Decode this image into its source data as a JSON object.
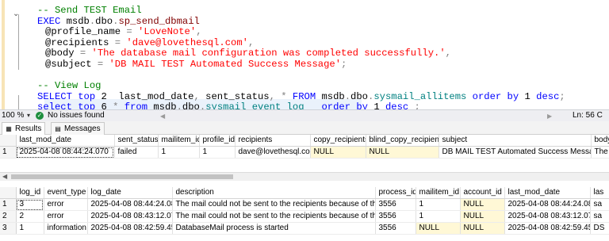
{
  "editor": {
    "lines": [
      [
        {
          "t": "-- Send TEST Email",
          "c": "cmt"
        }
      ],
      [
        {
          "t": "EXEC ",
          "c": "kw"
        },
        {
          "t": "msdb",
          "c": "blk"
        },
        {
          "t": ".",
          "c": "gray"
        },
        {
          "t": "dbo",
          "c": "blk"
        },
        {
          "t": ".",
          "c": "gray"
        },
        {
          "t": "sp_send_dbmail",
          "c": "fn"
        }
      ],
      [
        {
          "t": "@profile_name ",
          "c": "blk"
        },
        {
          "t": "= ",
          "c": "gray"
        },
        {
          "t": "'LoveNote'",
          "c": "str"
        },
        {
          "t": ",",
          "c": "gray"
        }
      ],
      [
        {
          "t": "@recipients ",
          "c": "blk"
        },
        {
          "t": "= ",
          "c": "gray"
        },
        {
          "t": "'dave@lovethesql.com'",
          "c": "str"
        },
        {
          "t": ",",
          "c": "gray"
        }
      ],
      [
        {
          "t": "@body ",
          "c": "blk"
        },
        {
          "t": "= ",
          "c": "gray"
        },
        {
          "t": "'The database mail configuration was completed successfully.'",
          "c": "str"
        },
        {
          "t": ",",
          "c": "gray"
        }
      ],
      [
        {
          "t": "@subject ",
          "c": "blk"
        },
        {
          "t": "= ",
          "c": "gray"
        },
        {
          "t": "'DB MAIL TEST Automated Success Message'",
          "c": "str"
        },
        {
          "t": ";",
          "c": "gray"
        }
      ],
      [],
      [
        {
          "t": "-- View Log",
          "c": "cmt"
        }
      ],
      [
        {
          "t": "SELECT ",
          "c": "kw"
        },
        {
          "t": "top ",
          "c": "kw"
        },
        {
          "t": "2  ",
          "c": "blk"
        },
        {
          "t": "last_mod_date",
          "c": "blk"
        },
        {
          "t": ", ",
          "c": "gray"
        },
        {
          "t": "sent_status",
          "c": "blk"
        },
        {
          "t": ", ",
          "c": "gray"
        },
        {
          "t": "* ",
          "c": "gray"
        },
        {
          "t": "FROM ",
          "c": "kw"
        },
        {
          "t": "msdb",
          "c": "blk"
        },
        {
          "t": ".",
          "c": "gray"
        },
        {
          "t": "dbo",
          "c": "blk"
        },
        {
          "t": ".",
          "c": "gray"
        },
        {
          "t": "sysmail_allitems ",
          "c": "obj"
        },
        {
          "t": "order by ",
          "c": "kw"
        },
        {
          "t": "1 ",
          "c": "blk"
        },
        {
          "t": "desc",
          "c": "kw"
        },
        {
          "t": ";",
          "c": "gray"
        }
      ],
      [
        {
          "t": "select ",
          "c": "kw"
        },
        {
          "t": "top ",
          "c": "kw"
        },
        {
          "t": "6 ",
          "c": "blk"
        },
        {
          "t": "* ",
          "c": "gray"
        },
        {
          "t": "from ",
          "c": "kw"
        },
        {
          "t": "msdb",
          "c": "blk"
        },
        {
          "t": ".",
          "c": "gray"
        },
        {
          "t": "dbo",
          "c": "blk"
        },
        {
          "t": ".",
          "c": "gray"
        },
        {
          "t": "sysmail_event_log   ",
          "c": "obj"
        },
        {
          "t": "order by ",
          "c": "kw"
        },
        {
          "t": "1 ",
          "c": "blk"
        },
        {
          "t": "desc ",
          "c": "kw"
        },
        {
          "t": ";",
          "c": "gray"
        }
      ]
    ]
  },
  "status": {
    "zoom": "100 %",
    "issues": "No issues found",
    "position": "Ln: 56   C"
  },
  "tabs": {
    "results": "Results",
    "messages": "Messages"
  },
  "grid1": {
    "columns": [
      "",
      "last_mod_date",
      "sent_status",
      "mailitem_id",
      "profile_id",
      "recipients",
      "copy_recipients",
      "blind_copy_recipients",
      "subject",
      "body"
    ],
    "rows": [
      [
        "1",
        "2025-04-08 08:44:24.070",
        "failed",
        "1",
        "1",
        "dave@lovethesql.com",
        "NULL",
        "NULL",
        "DB MAIL TEST Automated Success Message",
        "The d"
      ]
    ]
  },
  "grid2": {
    "columns": [
      "",
      "log_id",
      "event_type",
      "log_date",
      "description",
      "process_id",
      "mailitem_id",
      "account_id",
      "last_mod_date",
      "las"
    ],
    "rows": [
      [
        "1",
        "3",
        "error",
        "2025-04-08 08:44:24.087",
        "The mail could not be sent to the recipients because of the mail...",
        "3556",
        "1",
        "NULL",
        "2025-04-08 08:44:24.087",
        "sa"
      ],
      [
        "2",
        "2",
        "error",
        "2025-04-08 08:43:12.070",
        "The mail could not be sent to the recipients because of the mail...",
        "3556",
        "1",
        "NULL",
        "2025-04-08 08:43:12.070",
        "sa"
      ],
      [
        "3",
        "1",
        "information",
        "2025-04-08 08:42:59.450",
        "DatabaseMail process is started",
        "3556",
        "NULL",
        "NULL",
        "2025-04-08 08:42:59.450",
        "DS"
      ]
    ]
  },
  "colors": {
    "null_cell": "#fff8d6",
    "keyword": "#0000ff",
    "string": "#ff0000",
    "comment": "#008000",
    "object": "#008080",
    "procedure": "#800000"
  },
  "icons": {
    "results_tab": "grid-icon",
    "messages_tab": "message-icon",
    "status_ok": "check-circle-icon",
    "fold": "chevron-down-icon"
  }
}
